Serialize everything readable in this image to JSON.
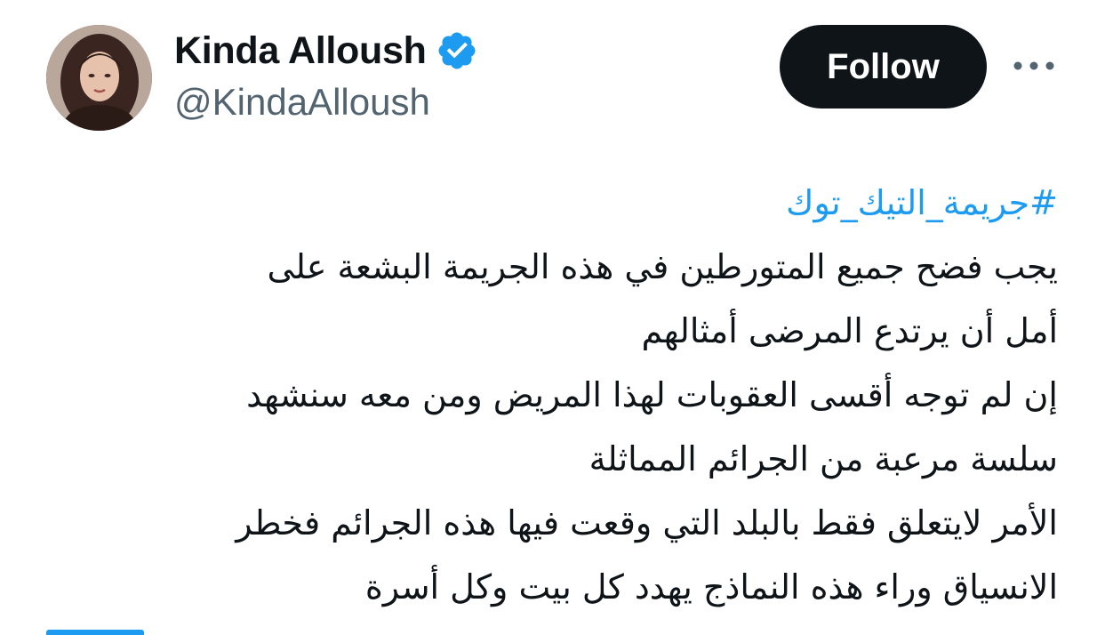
{
  "author": {
    "display_name": "Kinda Alloush",
    "handle": "@KindaAlloush",
    "verified_icon": "verified-badge-icon",
    "avatar_icon": "profile-photo"
  },
  "actions": {
    "follow_label": "Follow",
    "more_icon": "more-options-icon"
  },
  "tweet": {
    "hashtag": "#جريمة_التيك_توك",
    "lines": [
      "يجب فضح جميع المتورطين في هذه الجريمة البشعة على",
      "أمل أن يرتدع المرضى أمثالهم",
      "إن لم توجه أقسى العقوبات لهذا المريض ومن معه سنشهد",
      "سلسة مرعبة من الجرائم المماثلة",
      "الأمر لايتعلق فقط بالبلد التي وقعت فيها هذه الجرائم فخطر",
      "الانسياق وراء هذه النماذج يهدد كل بيت وكل أسرة"
    ]
  },
  "colors": {
    "text": "#0f1419",
    "secondary": "#536471",
    "link": "#1d9bf0",
    "button_bg": "#0f1419",
    "button_text": "#ffffff"
  }
}
